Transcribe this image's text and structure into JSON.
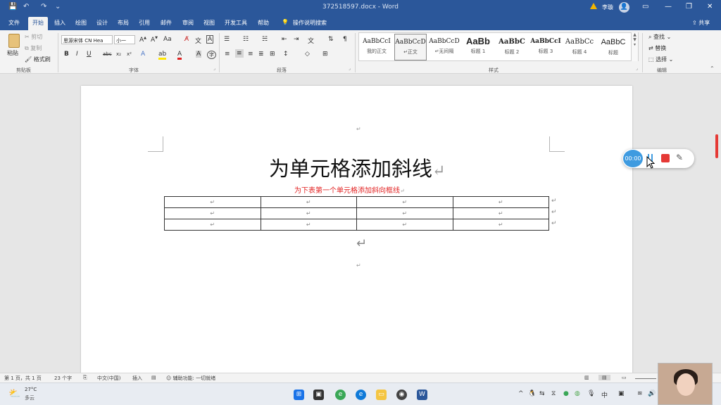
{
  "titlebar": {
    "doc_title": "372518597.docx  -  Word",
    "user_name": "李璇",
    "share_label": "共享",
    "tell_me": "操作说明搜索"
  },
  "tabs": [
    "文件",
    "开始",
    "插入",
    "绘图",
    "设计",
    "布局",
    "引用",
    "邮件",
    "审阅",
    "视图",
    "开发工具",
    "帮助"
  ],
  "active_tab": "开始",
  "ribbon": {
    "clipboard": {
      "paste": "粘贴",
      "cut": "剪切",
      "copy": "复制",
      "format_painter": "格式刷",
      "label": "剪贴板"
    },
    "font": {
      "font_name": "思源宋体 CN Hea",
      "font_size": "小一",
      "label": "字体"
    },
    "paragraph": {
      "label": "段落"
    },
    "styles": {
      "label": "样式",
      "items": [
        {
          "preview": "AaBbCcI",
          "name": "我的正文"
        },
        {
          "preview": "AaBbCcD",
          "name": "↵正文"
        },
        {
          "preview": "AaBbCcD",
          "name": "↵无间隔"
        },
        {
          "preview": "AaBb",
          "name": "标题 1"
        },
        {
          "preview": "AaBbC",
          "name": "标题 2"
        },
        {
          "preview": "AaBbCcI",
          "name": "标题 3"
        },
        {
          "preview": "AaBbCc",
          "name": "标题 4"
        },
        {
          "preview": "AaBbC",
          "name": "标题"
        }
      ]
    },
    "editing": {
      "find": "查找",
      "replace": "替换",
      "select": "选择",
      "label": "编辑"
    }
  },
  "document": {
    "title": "为单元格添加斜线",
    "subtitle": "为下表第一个单元格添加斜向框线",
    "paragraph_mark": "↵",
    "table_rows": 3,
    "table_cols": 4
  },
  "recorder": {
    "timer": "00:00"
  },
  "statusbar": {
    "page": "第 1 页，共 1 页",
    "words": "23 个字",
    "language": "中文(中国)",
    "insert_mode": "插入",
    "accessibility": "辅助功能: 一切就绪"
  },
  "weather": {
    "temp": "27°C",
    "desc": "多云"
  },
  "colors": {
    "brand": "#2b579a",
    "accent_red": "#e22222",
    "recorder_blue": "#3f9be0"
  }
}
